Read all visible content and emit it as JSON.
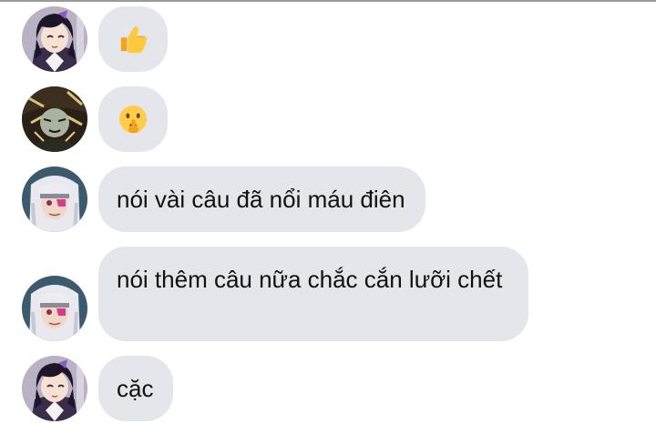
{
  "messages": [
    {
      "avatar_icon": "avatar-shinobu-icon",
      "type": "emoji",
      "emoji_icon": "thumbs-up-emoji-icon"
    },
    {
      "avatar_icon": "avatar-gyutaro-icon",
      "type": "emoji",
      "emoji_icon": "shushing-face-emoji-icon"
    },
    {
      "avatar_icon": "avatar-tengen-icon",
      "type": "text",
      "text": "nói vài câu đã nổi máu điên"
    },
    {
      "avatar_icon": "avatar-tengen-icon",
      "type": "text",
      "text": "nói thêm câu nữa chắc cắn lưỡi chết"
    },
    {
      "avatar_icon": "avatar-shinobu-icon",
      "type": "text",
      "text": "cặc"
    }
  ],
  "colors": {
    "bubble_bg": "#e4e6eb",
    "text": "#111111",
    "background": "#ffffff"
  }
}
